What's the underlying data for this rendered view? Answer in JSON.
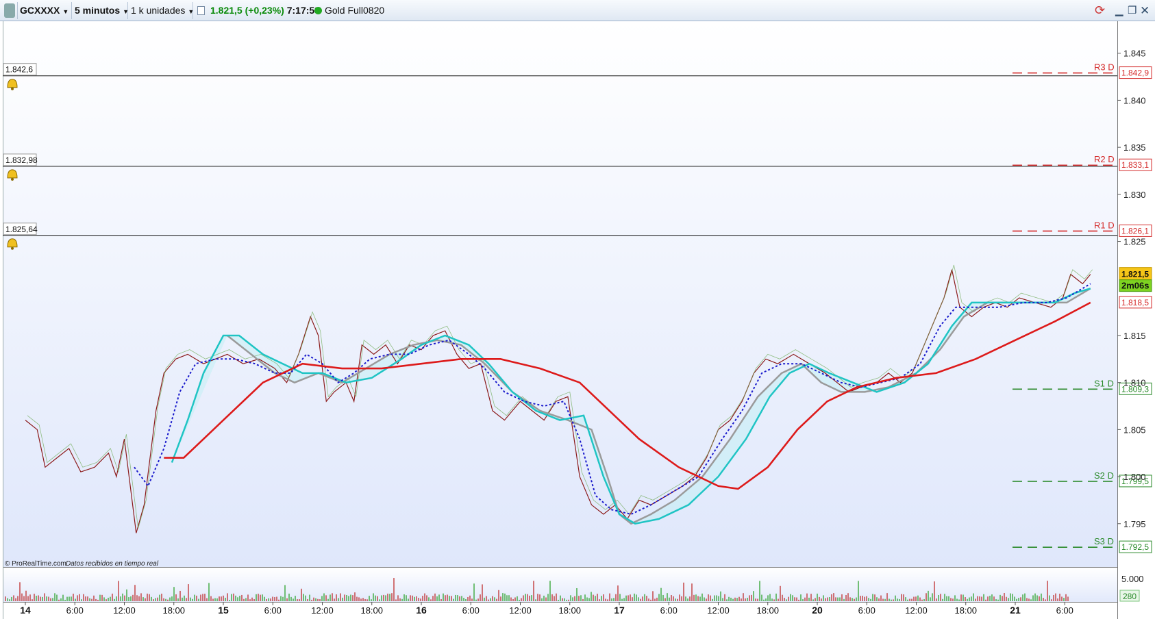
{
  "toolbar": {
    "symbol": "GCXXXX",
    "timeframe": "5 minutos",
    "units": "1 k unidades",
    "price": "1.821,5",
    "change": "(+0,23%)",
    "time": "7:17:53",
    "instrument": "Gold Full0820",
    "colors": {
      "price": "#0a8a0a",
      "dot": "#22aa22"
    }
  },
  "footer": {
    "credit": "© ProRealTime.com",
    "note": "Datos recibidos en tiempo real"
  },
  "volume": {
    "label_top": "5.000",
    "label_current": "280"
  },
  "chart_data": {
    "type": "line",
    "ylim": [
      1790.4,
      1848.4
    ],
    "yticks": [
      {
        "v": 1845,
        "label": "1.845"
      },
      {
        "v": 1840,
        "label": "1.840"
      },
      {
        "v": 1835,
        "label": "1.835"
      },
      {
        "v": 1830,
        "label": "1.830"
      },
      {
        "v": 1825,
        "label": "1.825"
      },
      {
        "v": 1815,
        "label": "1.815"
      },
      {
        "v": 1810,
        "label": "1.810"
      },
      {
        "v": 1805,
        "label": "1.805"
      },
      {
        "v": 1800,
        "label": "1.800"
      },
      {
        "v": 1795,
        "label": "1.795"
      }
    ],
    "x_ticks": [
      {
        "d": 0,
        "label": "14",
        "bold": true
      },
      {
        "d": 0.25,
        "label": "6:00"
      },
      {
        "d": 0.5,
        "label": "12:00"
      },
      {
        "d": 0.75,
        "label": "18:00"
      },
      {
        "d": 1,
        "label": "15",
        "bold": true
      },
      {
        "d": 1.25,
        "label": "6:00"
      },
      {
        "d": 1.5,
        "label": "12:00"
      },
      {
        "d": 1.75,
        "label": "18:00"
      },
      {
        "d": 2,
        "label": "16",
        "bold": true
      },
      {
        "d": 2.25,
        "label": "6:00"
      },
      {
        "d": 2.5,
        "label": "12:00"
      },
      {
        "d": 2.75,
        "label": "18:00"
      },
      {
        "d": 3,
        "label": "17",
        "bold": true
      },
      {
        "d": 3.25,
        "label": "6:00"
      },
      {
        "d": 3.5,
        "label": "12:00"
      },
      {
        "d": 3.75,
        "label": "18:00"
      },
      {
        "d": 4,
        "label": "20",
        "bold": true
      },
      {
        "d": 4.25,
        "label": "6:00"
      },
      {
        "d": 4.5,
        "label": "12:00"
      },
      {
        "d": 4.75,
        "label": "18:00"
      },
      {
        "d": 5,
        "label": "21",
        "bold": true
      },
      {
        "d": 5.25,
        "label": "6:00"
      }
    ],
    "alert_lines": [
      {
        "v": 1842.6,
        "label": "1.842,6"
      },
      {
        "v": 1832.98,
        "label": "1.832,98"
      },
      {
        "v": 1825.64,
        "label": "1.825,64"
      }
    ],
    "pivots": [
      {
        "name": "R3 D",
        "v": 1842.9,
        "label": "1.842,9",
        "color": "#d42a2a"
      },
      {
        "name": "R2 D",
        "v": 1833.1,
        "label": "1.833,1",
        "color": "#d42a2a"
      },
      {
        "name": "R1 D",
        "v": 1826.1,
        "label": "1.826,1",
        "color": "#d42a2a"
      },
      {
        "name": "S1 D",
        "v": 1809.3,
        "label": "1.809,3",
        "color": "#2a8a2a"
      },
      {
        "name": "S2 D",
        "v": 1799.5,
        "label": "1.799,5",
        "color": "#2a8a2a"
      },
      {
        "name": "S3 D",
        "v": 1792.5,
        "label": "1.792,5",
        "color": "#2a8a2a"
      }
    ],
    "current": {
      "v": 1821.5,
      "label": "1.821,5",
      "countdown": "2m06s"
    },
    "ma_red_marker": {
      "v": 1818.5,
      "label": "1.818,5"
    },
    "price_path": [
      [
        0,
        1806
      ],
      [
        0.06,
        1805
      ],
      [
        0.1,
        1801
      ],
      [
        0.16,
        1802
      ],
      [
        0.22,
        1803
      ],
      [
        0.28,
        1800.5
      ],
      [
        0.35,
        1801
      ],
      [
        0.42,
        1802.5
      ],
      [
        0.46,
        1800
      ],
      [
        0.5,
        1804
      ],
      [
        0.56,
        1794
      ],
      [
        0.6,
        1797
      ],
      [
        0.66,
        1807
      ],
      [
        0.7,
        1811
      ],
      [
        0.76,
        1812.5
      ],
      [
        0.82,
        1813
      ],
      [
        0.9,
        1812
      ],
      [
        0.96,
        1812.5
      ],
      [
        1.02,
        1813
      ],
      [
        1.1,
        1812
      ],
      [
        1.18,
        1812.5
      ],
      [
        1.26,
        1811.5
      ],
      [
        1.32,
        1810
      ],
      [
        1.38,
        1813
      ],
      [
        1.44,
        1817
      ],
      [
        1.48,
        1815
      ],
      [
        1.52,
        1808
      ],
      [
        1.56,
        1809
      ],
      [
        1.62,
        1810
      ],
      [
        1.66,
        1808
      ],
      [
        1.7,
        1814
      ],
      [
        1.76,
        1813
      ],
      [
        1.82,
        1814
      ],
      [
        1.88,
        1812
      ],
      [
        1.94,
        1814
      ],
      [
        2.0,
        1813.5
      ],
      [
        2.06,
        1815
      ],
      [
        2.12,
        1815.5
      ],
      [
        2.18,
        1813
      ],
      [
        2.24,
        1811.5
      ],
      [
        2.3,
        1812
      ],
      [
        2.36,
        1807
      ],
      [
        2.42,
        1806
      ],
      [
        2.5,
        1808
      ],
      [
        2.56,
        1807
      ],
      [
        2.62,
        1806
      ],
      [
        2.68,
        1808
      ],
      [
        2.74,
        1808.5
      ],
      [
        2.8,
        1800
      ],
      [
        2.86,
        1797
      ],
      [
        2.92,
        1796
      ],
      [
        2.98,
        1797
      ],
      [
        3.04,
        1795.5
      ],
      [
        3.1,
        1797.5
      ],
      [
        3.16,
        1797
      ],
      [
        3.24,
        1798
      ],
      [
        3.32,
        1799
      ],
      [
        3.38,
        1800
      ],
      [
        3.44,
        1802
      ],
      [
        3.5,
        1805
      ],
      [
        3.56,
        1806
      ],
      [
        3.62,
        1808
      ],
      [
        3.68,
        1811
      ],
      [
        3.74,
        1812.5
      ],
      [
        3.8,
        1812
      ],
      [
        3.88,
        1813
      ],
      [
        3.96,
        1812
      ],
      [
        4.04,
        1811
      ],
      [
        4.1,
        1810
      ],
      [
        4.16,
        1809
      ],
      [
        4.22,
        1809.5
      ],
      [
        4.3,
        1810
      ],
      [
        4.36,
        1811
      ],
      [
        4.42,
        1810
      ],
      [
        4.48,
        1811
      ],
      [
        4.54,
        1814
      ],
      [
        4.6,
        1817
      ],
      [
        4.64,
        1819
      ],
      [
        4.68,
        1822
      ],
      [
        4.72,
        1818
      ],
      [
        4.78,
        1817
      ],
      [
        4.84,
        1818
      ],
      [
        4.9,
        1818.5
      ],
      [
        4.96,
        1818
      ],
      [
        5.02,
        1819
      ],
      [
        5.1,
        1818.5
      ],
      [
        5.18,
        1818
      ],
      [
        5.24,
        1819
      ],
      [
        5.28,
        1821.5
      ],
      [
        5.34,
        1820.5
      ],
      [
        5.38,
        1821.5
      ]
    ],
    "ma_red": [
      [
        0.7,
        1802
      ],
      [
        0.8,
        1802
      ],
      [
        1.0,
        1806
      ],
      [
        1.2,
        1810
      ],
      [
        1.4,
        1812
      ],
      [
        1.6,
        1811.5
      ],
      [
        1.8,
        1811.5
      ],
      [
        2.0,
        1812
      ],
      [
        2.2,
        1812.5
      ],
      [
        2.4,
        1812.5
      ],
      [
        2.6,
        1811.5
      ],
      [
        2.8,
        1810
      ],
      [
        2.95,
        1807
      ],
      [
        3.1,
        1804
      ],
      [
        3.3,
        1801
      ],
      [
        3.5,
        1799
      ],
      [
        3.6,
        1798.7
      ],
      [
        3.75,
        1801
      ],
      [
        3.9,
        1805
      ],
      [
        4.05,
        1808
      ],
      [
        4.2,
        1809.5
      ],
      [
        4.4,
        1810.5
      ],
      [
        4.6,
        1811
      ],
      [
        4.8,
        1812.5
      ],
      [
        5.0,
        1814.5
      ],
      [
        5.2,
        1816.5
      ],
      [
        5.38,
        1818.5
      ]
    ],
    "ma_cyan": [
      [
        0.74,
        1801.5
      ],
      [
        0.82,
        1806
      ],
      [
        0.9,
        1811
      ],
      [
        1.0,
        1815
      ],
      [
        1.08,
        1815
      ],
      [
        1.2,
        1813
      ],
      [
        1.3,
        1812
      ],
      [
        1.4,
        1811
      ],
      [
        1.5,
        1811
      ],
      [
        1.62,
        1810
      ],
      [
        1.75,
        1810.5
      ],
      [
        1.9,
        1812.5
      ],
      [
        2.0,
        1814
      ],
      [
        2.12,
        1815
      ],
      [
        2.24,
        1814
      ],
      [
        2.34,
        1812
      ],
      [
        2.46,
        1809
      ],
      [
        2.58,
        1807
      ],
      [
        2.7,
        1806
      ],
      [
        2.82,
        1806.5
      ],
      [
        2.92,
        1800
      ],
      [
        3.0,
        1796
      ],
      [
        3.08,
        1795
      ],
      [
        3.2,
        1795.5
      ],
      [
        3.35,
        1797
      ],
      [
        3.5,
        1800
      ],
      [
        3.64,
        1804
      ],
      [
        3.76,
        1808.5
      ],
      [
        3.86,
        1811
      ],
      [
        3.96,
        1812
      ],
      [
        4.06,
        1811
      ],
      [
        4.18,
        1810
      ],
      [
        4.3,
        1809
      ],
      [
        4.44,
        1810
      ],
      [
        4.56,
        1812
      ],
      [
        4.68,
        1816
      ],
      [
        4.78,
        1818.5
      ],
      [
        4.9,
        1818.5
      ],
      [
        5.06,
        1818.5
      ],
      [
        5.2,
        1818.5
      ],
      [
        5.3,
        1819.5
      ],
      [
        5.38,
        1820
      ]
    ],
    "ma_gray": [
      [
        1.02,
        1815
      ],
      [
        1.14,
        1813
      ],
      [
        1.26,
        1811
      ],
      [
        1.36,
        1810
      ],
      [
        1.48,
        1811
      ],
      [
        1.6,
        1810
      ],
      [
        1.72,
        1811.5
      ],
      [
        1.84,
        1813
      ],
      [
        1.96,
        1814
      ],
      [
        2.08,
        1814.5
      ],
      [
        2.2,
        1814
      ],
      [
        2.32,
        1812
      ],
      [
        2.46,
        1809
      ],
      [
        2.6,
        1807
      ],
      [
        2.74,
        1806
      ],
      [
        2.86,
        1805
      ],
      [
        2.94,
        1800
      ],
      [
        3.0,
        1796
      ],
      [
        3.06,
        1795
      ],
      [
        3.16,
        1796
      ],
      [
        3.28,
        1797.5
      ],
      [
        3.42,
        1800
      ],
      [
        3.56,
        1804
      ],
      [
        3.7,
        1808.5
      ],
      [
        3.82,
        1811
      ],
      [
        3.92,
        1812
      ],
      [
        4.02,
        1810
      ],
      [
        4.12,
        1809
      ],
      [
        4.24,
        1809
      ],
      [
        4.36,
        1809.5
      ],
      [
        4.5,
        1811
      ],
      [
        4.62,
        1813.5
      ],
      [
        4.74,
        1817
      ],
      [
        4.86,
        1818.5
      ],
      [
        5.0,
        1818.5
      ],
      [
        5.14,
        1818.5
      ],
      [
        5.26,
        1818.5
      ],
      [
        5.38,
        1820
      ]
    ],
    "ma_blue_dotted": [
      [
        0.55,
        1801
      ],
      [
        0.62,
        1799
      ],
      [
        0.7,
        1803
      ],
      [
        0.78,
        1809
      ],
      [
        0.86,
        1812
      ],
      [
        0.96,
        1812.5
      ],
      [
        1.06,
        1812.5
      ],
      [
        1.16,
        1812
      ],
      [
        1.26,
        1811
      ],
      [
        1.34,
        1811
      ],
      [
        1.42,
        1813
      ],
      [
        1.5,
        1812
      ],
      [
        1.58,
        1810
      ],
      [
        1.66,
        1811
      ],
      [
        1.74,
        1812.5
      ],
      [
        1.84,
        1813
      ],
      [
        1.94,
        1813
      ],
      [
        2.04,
        1814
      ],
      [
        2.14,
        1814.5
      ],
      [
        2.24,
        1813
      ],
      [
        2.32,
        1811.5
      ],
      [
        2.42,
        1809
      ],
      [
        2.52,
        1808
      ],
      [
        2.62,
        1807.5
      ],
      [
        2.72,
        1808
      ],
      [
        2.8,
        1804
      ],
      [
        2.88,
        1798
      ],
      [
        2.96,
        1796.5
      ],
      [
        3.06,
        1796
      ],
      [
        3.16,
        1797
      ],
      [
        3.28,
        1798.5
      ],
      [
        3.4,
        1800
      ],
      [
        3.52,
        1804
      ],
      [
        3.62,
        1807
      ],
      [
        3.72,
        1811
      ],
      [
        3.82,
        1812
      ],
      [
        3.92,
        1812
      ],
      [
        4.02,
        1811
      ],
      [
        4.12,
        1810
      ],
      [
        4.22,
        1809.5
      ],
      [
        4.32,
        1810
      ],
      [
        4.42,
        1810.5
      ],
      [
        4.52,
        1812
      ],
      [
        4.62,
        1816
      ],
      [
        4.7,
        1818
      ],
      [
        4.8,
        1818
      ],
      [
        4.92,
        1818
      ],
      [
        5.04,
        1818.5
      ],
      [
        5.16,
        1818.5
      ],
      [
        5.26,
        1819
      ],
      [
        5.38,
        1820.5
      ]
    ]
  }
}
